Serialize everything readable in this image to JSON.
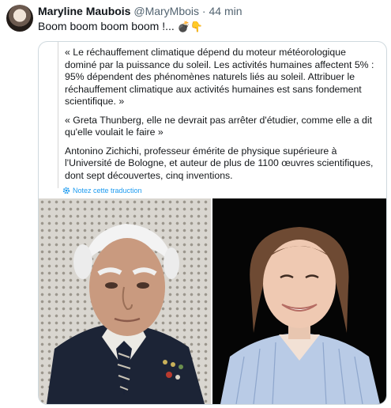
{
  "tweet": {
    "author_name": "Maryline Maubois",
    "handle": "@MaryMbois",
    "separator": "·",
    "time": "44 min",
    "text": "Boom boom boom boom !...",
    "emojis": "💣👇"
  },
  "quote": {
    "paragraphs": [
      "« Le réchauffement climatique dépend du moteur météorologique dominé par la puissance du soleil. Les activités humaines affectent 5% : 95% dépendent des phénomènes naturels liés au soleil. Attribuer le réchauffement climatique aux activités humaines est sans fondement scientifique. »",
      "« Greta Thunberg, elle ne devrait pas arrêter d'étudier, comme elle a dit qu'elle voulait le faire »",
      "Antonino Zichichi, professeur émérite de physique supérieure à l'Université de Bologne, et auteur de plus de 1100 œuvres scientifiques, dont sept découvertes, cinq inventions."
    ],
    "translate_label": "Notez cette traduction"
  },
  "colors": {
    "link": "#1d9bf0",
    "muted": "#536471",
    "text": "#0f1419",
    "border": "#cfd9de"
  },
  "icons": [
    "gear-icon"
  ]
}
